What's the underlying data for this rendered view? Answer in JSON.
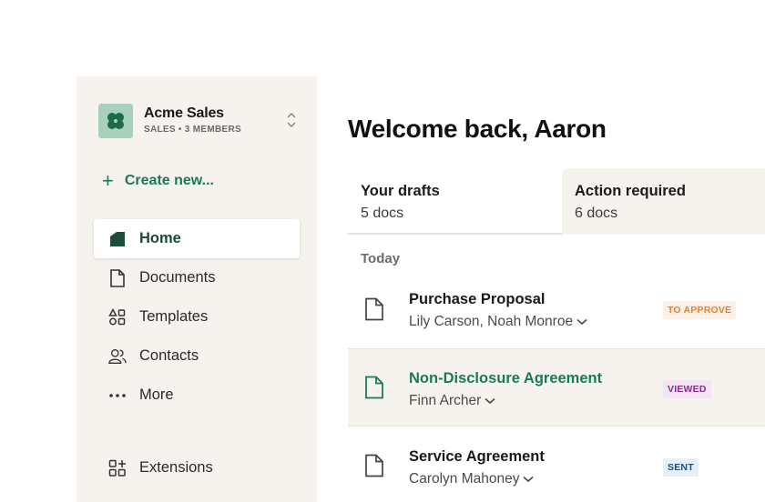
{
  "workspace": {
    "name": "Acme Sales",
    "subtitle": "SALES • 3 MEMBERS"
  },
  "sidebar": {
    "create_label": "Create new...",
    "items": [
      {
        "label": "Home",
        "icon": "home-icon",
        "active": true
      },
      {
        "label": "Documents",
        "icon": "document-icon"
      },
      {
        "label": "Templates",
        "icon": "templates-icon"
      },
      {
        "label": "Contacts",
        "icon": "contacts-icon"
      },
      {
        "label": "More",
        "icon": "more-icon"
      }
    ],
    "extensions_label": "Extensions"
  },
  "main": {
    "welcome": "Welcome back, Aaron",
    "tabs": [
      {
        "title": "Your drafts",
        "subtitle": "5 docs"
      },
      {
        "title": "Action required",
        "subtitle": "6 docs"
      }
    ],
    "section": "Today",
    "documents": [
      {
        "title": "Purchase Proposal",
        "people": "Lily Carson, Noah Monroe",
        "status": "TO APPROVE"
      },
      {
        "title": "Non-Disclosure Agreement",
        "people": "Finn Archer",
        "status": "VIEWED"
      },
      {
        "title": "Service Agreement",
        "people": "Carolyn Mahoney",
        "status": "SENT"
      }
    ]
  },
  "colors": {
    "accent": "#1b7a55",
    "sidebar_bg": "#f6f3ef",
    "logo_bg": "#a9cfbd"
  }
}
